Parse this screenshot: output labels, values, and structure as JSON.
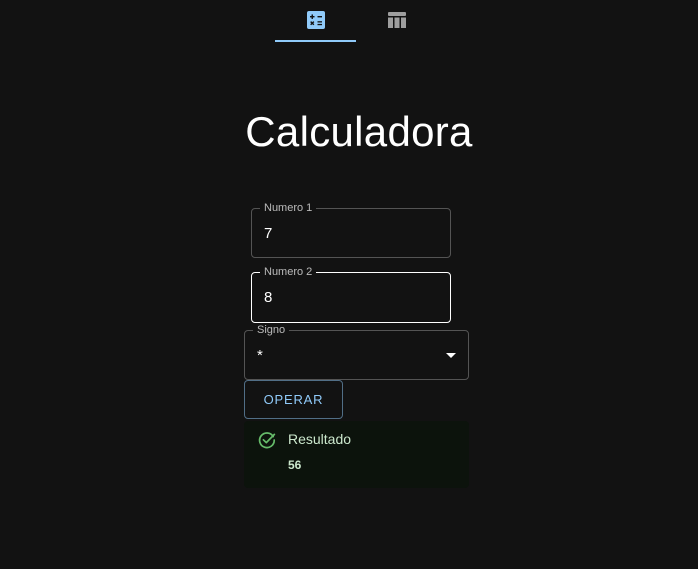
{
  "tabs": [
    {
      "icon": "calculator-icon",
      "selected": true
    },
    {
      "icon": "table-icon",
      "selected": false
    }
  ],
  "colors": {
    "background": "#121212",
    "accent": "#90caf9",
    "success": "#66bb6a",
    "success_text": "#cce8cd"
  },
  "title": "Calculadora",
  "form": {
    "numero1": {
      "label": "Numero 1",
      "value": "7"
    },
    "numero2": {
      "label": "Numero 2",
      "value": "8"
    },
    "signo": {
      "label": "Signo",
      "value": "*"
    },
    "submit_label": "OPERAR"
  },
  "result": {
    "icon": "check-circle-icon",
    "title": "Resultado",
    "value": "56"
  }
}
